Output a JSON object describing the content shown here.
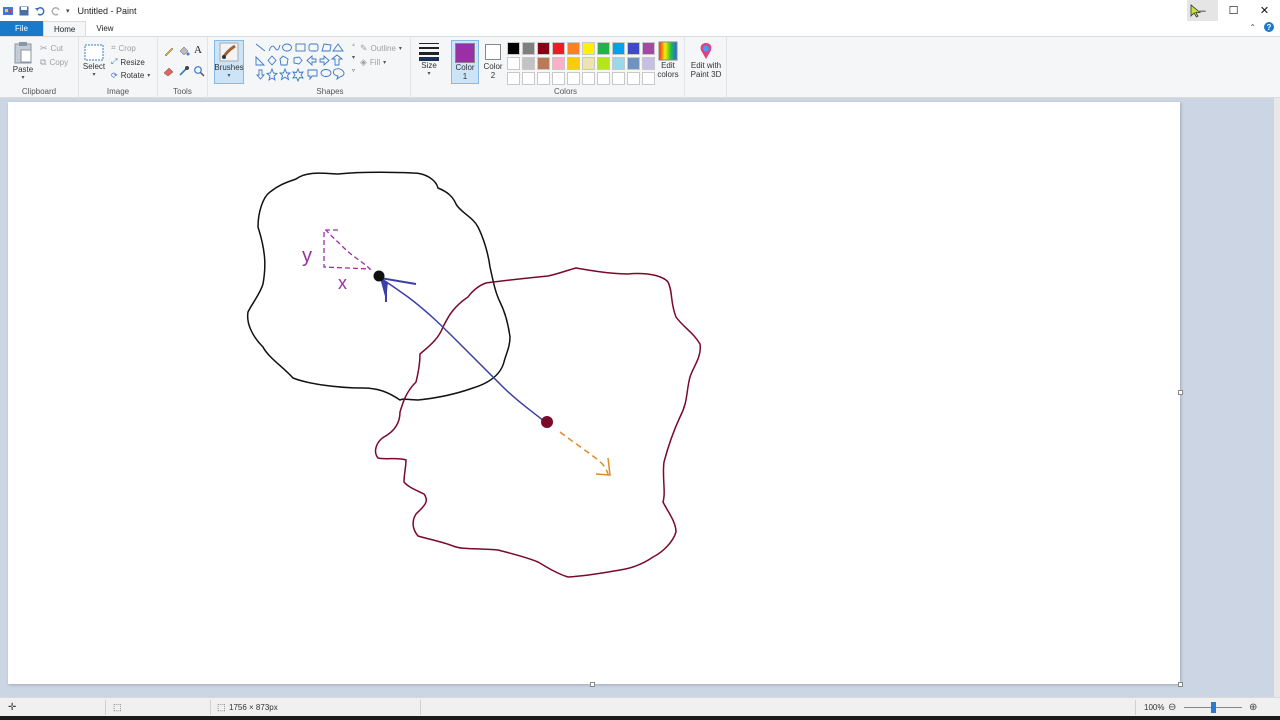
{
  "window": {
    "title": "Untitled - Paint",
    "minimize": "–",
    "maximize": "☐",
    "close": "✕"
  },
  "tabs": [
    "File",
    "Home",
    "View"
  ],
  "ribbon": {
    "clipboard": {
      "label": "Clipboard",
      "paste": "Paste",
      "cut": "Cut",
      "copy": "Copy"
    },
    "image": {
      "label": "Image",
      "select": "Select",
      "crop": "Crop",
      "resize": "Resize",
      "rotate": "Rotate"
    },
    "tools": {
      "label": "Tools"
    },
    "brushes": {
      "label": "Brushes"
    },
    "shapes": {
      "label": "Shapes",
      "outline": "Outline",
      "fill": "Fill"
    },
    "size": {
      "label": "Size"
    },
    "colors": {
      "label": "Colors",
      "color1": "Color",
      "color1_num": "1",
      "color2": "Color",
      "color2_num": "2",
      "edit_colors_1": "Edit",
      "edit_colors_2": "colors",
      "paint3d_1": "Edit with",
      "paint3d_2": "Paint 3D",
      "color1_value": "#9b2fa5",
      "color2_value": "#ffffff",
      "palette": [
        "#000000",
        "#7f7f7f",
        "#880015",
        "#ed1c24",
        "#ff7f27",
        "#fff200",
        "#22b14c",
        "#00a2e8",
        "#3f48cc",
        "#a349a4",
        "#ffffff",
        "#c3c3c3",
        "#b97a57",
        "#ffaec9",
        "#ffc90e",
        "#efe4b0",
        "#b5e61d",
        "#99d9ea",
        "#7092be",
        "#c8bfe7",
        "#ffffff",
        "#ffffff",
        "#ffffff",
        "#ffffff",
        "#ffffff",
        "#ffffff",
        "#ffffff",
        "#ffffff",
        "#ffffff",
        "#ffffff"
      ]
    }
  },
  "drawing": {
    "label_y": "y",
    "label_x": "x"
  },
  "status": {
    "dimensions": "1756 × 873px",
    "zoom": "100%",
    "zoom_level": 0.5
  }
}
